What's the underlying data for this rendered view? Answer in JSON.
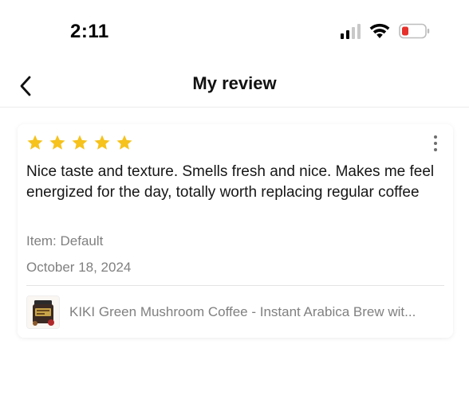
{
  "status_bar": {
    "time": "2:11",
    "icons": [
      "cellular-signal-icon",
      "wifi-icon",
      "battery-low-icon"
    ],
    "battery_color": "#e5312b"
  },
  "nav": {
    "back_icon": "chevron-left-icon",
    "title": "My review"
  },
  "review": {
    "rating": 5,
    "rating_max": 5,
    "star_color": "#f6c21c",
    "text": "Nice taste and texture. Smells fresh and nice. Makes me feel energized for the day, totally worth replacing regular coffee",
    "item": "Item: Default",
    "date": "October 18, 2024",
    "more_icon": "more-vertical-icon",
    "product": {
      "name": "KIKI Green Mushroom Coffee - Instant Arabica Brew wit...",
      "thumbnail_icon": "product-thumbnail"
    }
  }
}
